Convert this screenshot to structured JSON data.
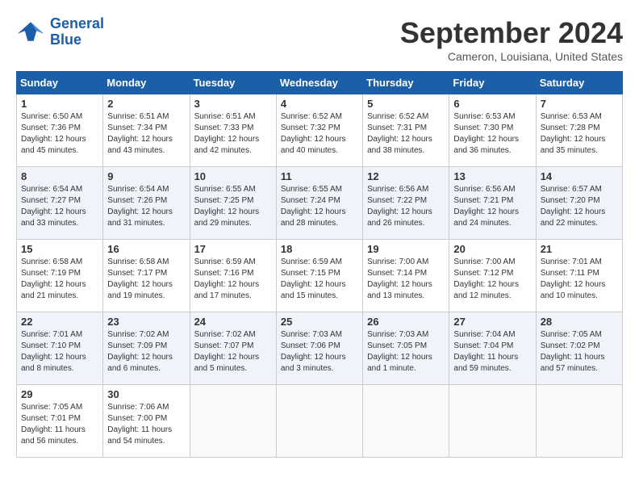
{
  "logo": {
    "line1": "General",
    "line2": "Blue"
  },
  "title": "September 2024",
  "subtitle": "Cameron, Louisiana, United States",
  "days_of_week": [
    "Sunday",
    "Monday",
    "Tuesday",
    "Wednesday",
    "Thursday",
    "Friday",
    "Saturday"
  ],
  "weeks": [
    [
      {
        "day": "1",
        "sunrise": "6:50 AM",
        "sunset": "7:36 PM",
        "daylight": "12 hours and 45 minutes."
      },
      {
        "day": "2",
        "sunrise": "6:51 AM",
        "sunset": "7:34 PM",
        "daylight": "12 hours and 43 minutes."
      },
      {
        "day": "3",
        "sunrise": "6:51 AM",
        "sunset": "7:33 PM",
        "daylight": "12 hours and 42 minutes."
      },
      {
        "day": "4",
        "sunrise": "6:52 AM",
        "sunset": "7:32 PM",
        "daylight": "12 hours and 40 minutes."
      },
      {
        "day": "5",
        "sunrise": "6:52 AM",
        "sunset": "7:31 PM",
        "daylight": "12 hours and 38 minutes."
      },
      {
        "day": "6",
        "sunrise": "6:53 AM",
        "sunset": "7:30 PM",
        "daylight": "12 hours and 36 minutes."
      },
      {
        "day": "7",
        "sunrise": "6:53 AM",
        "sunset": "7:28 PM",
        "daylight": "12 hours and 35 minutes."
      }
    ],
    [
      {
        "day": "8",
        "sunrise": "6:54 AM",
        "sunset": "7:27 PM",
        "daylight": "12 hours and 33 minutes."
      },
      {
        "day": "9",
        "sunrise": "6:54 AM",
        "sunset": "7:26 PM",
        "daylight": "12 hours and 31 minutes."
      },
      {
        "day": "10",
        "sunrise": "6:55 AM",
        "sunset": "7:25 PM",
        "daylight": "12 hours and 29 minutes."
      },
      {
        "day": "11",
        "sunrise": "6:55 AM",
        "sunset": "7:24 PM",
        "daylight": "12 hours and 28 minutes."
      },
      {
        "day": "12",
        "sunrise": "6:56 AM",
        "sunset": "7:22 PM",
        "daylight": "12 hours and 26 minutes."
      },
      {
        "day": "13",
        "sunrise": "6:56 AM",
        "sunset": "7:21 PM",
        "daylight": "12 hours and 24 minutes."
      },
      {
        "day": "14",
        "sunrise": "6:57 AM",
        "sunset": "7:20 PM",
        "daylight": "12 hours and 22 minutes."
      }
    ],
    [
      {
        "day": "15",
        "sunrise": "6:58 AM",
        "sunset": "7:19 PM",
        "daylight": "12 hours and 21 minutes."
      },
      {
        "day": "16",
        "sunrise": "6:58 AM",
        "sunset": "7:17 PM",
        "daylight": "12 hours and 19 minutes."
      },
      {
        "day": "17",
        "sunrise": "6:59 AM",
        "sunset": "7:16 PM",
        "daylight": "12 hours and 17 minutes."
      },
      {
        "day": "18",
        "sunrise": "6:59 AM",
        "sunset": "7:15 PM",
        "daylight": "12 hours and 15 minutes."
      },
      {
        "day": "19",
        "sunrise": "7:00 AM",
        "sunset": "7:14 PM",
        "daylight": "12 hours and 13 minutes."
      },
      {
        "day": "20",
        "sunrise": "7:00 AM",
        "sunset": "7:12 PM",
        "daylight": "12 hours and 12 minutes."
      },
      {
        "day": "21",
        "sunrise": "7:01 AM",
        "sunset": "7:11 PM",
        "daylight": "12 hours and 10 minutes."
      }
    ],
    [
      {
        "day": "22",
        "sunrise": "7:01 AM",
        "sunset": "7:10 PM",
        "daylight": "12 hours and 8 minutes."
      },
      {
        "day": "23",
        "sunrise": "7:02 AM",
        "sunset": "7:09 PM",
        "daylight": "12 hours and 6 minutes."
      },
      {
        "day": "24",
        "sunrise": "7:02 AM",
        "sunset": "7:07 PM",
        "daylight": "12 hours and 5 minutes."
      },
      {
        "day": "25",
        "sunrise": "7:03 AM",
        "sunset": "7:06 PM",
        "daylight": "12 hours and 3 minutes."
      },
      {
        "day": "26",
        "sunrise": "7:03 AM",
        "sunset": "7:05 PM",
        "daylight": "12 hours and 1 minute."
      },
      {
        "day": "27",
        "sunrise": "7:04 AM",
        "sunset": "7:04 PM",
        "daylight": "11 hours and 59 minutes."
      },
      {
        "day": "28",
        "sunrise": "7:05 AM",
        "sunset": "7:02 PM",
        "daylight": "11 hours and 57 minutes."
      }
    ],
    [
      {
        "day": "29",
        "sunrise": "7:05 AM",
        "sunset": "7:01 PM",
        "daylight": "11 hours and 56 minutes."
      },
      {
        "day": "30",
        "sunrise": "7:06 AM",
        "sunset": "7:00 PM",
        "daylight": "11 hours and 54 minutes."
      },
      {
        "day": "",
        "sunrise": "",
        "sunset": "",
        "daylight": ""
      },
      {
        "day": "",
        "sunrise": "",
        "sunset": "",
        "daylight": ""
      },
      {
        "day": "",
        "sunrise": "",
        "sunset": "",
        "daylight": ""
      },
      {
        "day": "",
        "sunrise": "",
        "sunset": "",
        "daylight": ""
      },
      {
        "day": "",
        "sunrise": "",
        "sunset": "",
        "daylight": ""
      }
    ]
  ],
  "labels": {
    "sunrise": "Sunrise:",
    "sunset": "Sunset:",
    "daylight": "Daylight:"
  }
}
